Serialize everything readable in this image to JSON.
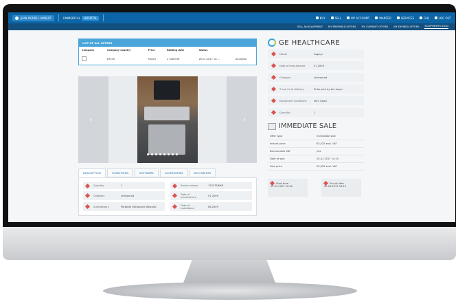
{
  "topbar": {
    "user": "JEAN PIERRE LAMBERT",
    "company_label": "UNIMEDICAL",
    "company_badge": "HOSPITAL",
    "nav": [
      "BUY",
      "SELL",
      "MY ACCOUNT",
      "WANTED",
      "SERVICES",
      "FAQ",
      "LOG OUT"
    ]
  },
  "subnav": [
    "SELL AN EQUIPMENT",
    "MY PREPARED OFFERS",
    "MY CURRENT OFFERS",
    "MY EXPIRED OFFERS",
    "EQUIPMENTS SOLD"
  ],
  "offers": {
    "title": "LIST OF ALL OFFERS",
    "headers": [
      "Company",
      "Company country",
      "Price",
      "Bidding date",
      "Status"
    ],
    "row": {
      "company_country": "87030",
      "country": "France",
      "price": "2 026 EUR",
      "bidding_date": "20.01.2017 14:...",
      "status": "accepted"
    }
  },
  "tabs": [
    "DESCRIPTION",
    "CONDITIONS",
    "SOFTWARE",
    "ACCESSORIES",
    "DOCUMENTS"
  ],
  "description": [
    {
      "label": "Quantity",
      "value": "1"
    },
    {
      "label": "Serial number",
      "value": "12237SWXR"
    },
    {
      "label": "Category",
      "value": "ultrasound"
    },
    {
      "label": "Date of manufacture",
      "value": "07.2009"
    },
    {
      "label": "Subcategory",
      "value": "Portable Ultrasound Vascular"
    },
    {
      "label": "Date of installation",
      "value": "08.2009"
    }
  ],
  "brand": "GE HEALTHCARE",
  "spec": [
    {
      "label": "Model",
      "value": "Logiq e"
    },
    {
      "label": "Date of manufacture",
      "value": "07.2009"
    },
    {
      "label": "Category",
      "value": "ultrasound"
    },
    {
      "label": "T and Cs of delivery",
      "value": "To be pick by the buyer"
    },
    {
      "label": "Equipment Conditions",
      "value": "Very Good"
    },
    {
      "label": "Quantity",
      "value": "1"
    }
  ],
  "sale": {
    "title": "IMMEDIATE SALE",
    "rows": [
      {
        "label": "Offer type",
        "value": "Immediate sale"
      },
      {
        "label": "Instant price",
        "value": "€3,025 excl. VAT"
      },
      {
        "label": "Recoverable VAT",
        "value": "yes"
      },
      {
        "label": "Date of sale",
        "value": "20.01.2017 14:10"
      },
      {
        "label": "Sale price",
        "value": "€3,025 excl. VAT"
      }
    ],
    "start": {
      "label": "Start time",
      "value": "19.01.2017 12:02"
    },
    "end": {
      "label": "End of offer",
      "value": "20.01.2017 14:10"
    }
  }
}
